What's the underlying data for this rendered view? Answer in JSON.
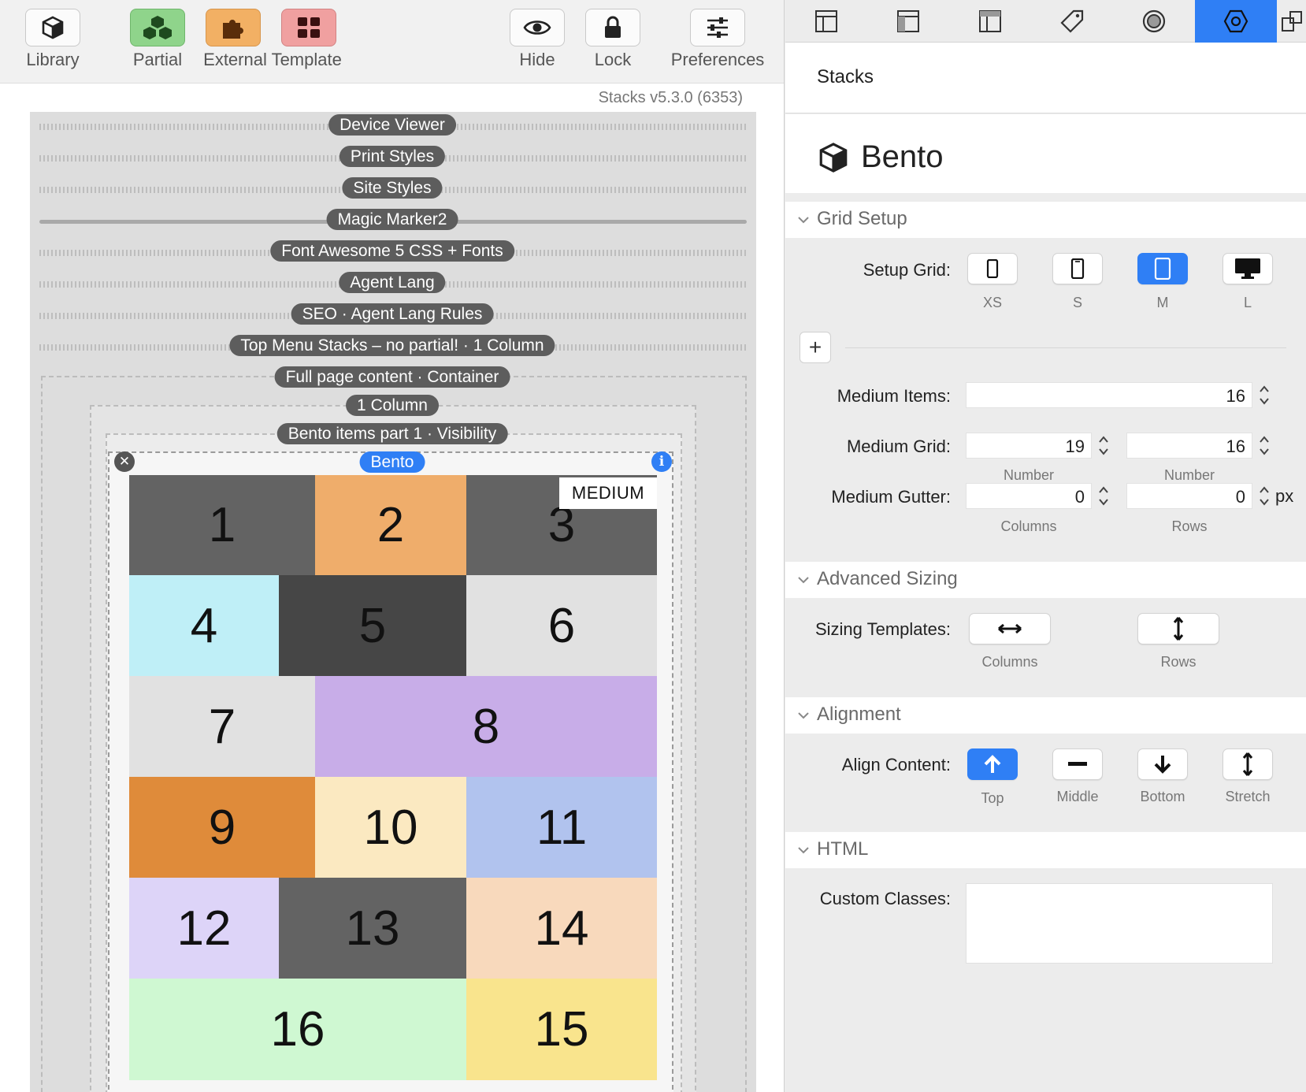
{
  "toolbar": {
    "library": "Library",
    "partial": "Partial",
    "external_template": "External Template",
    "hide": "Hide",
    "lock": "Lock",
    "preferences": "Preferences"
  },
  "version": "Stacks v5.3.0 (6353)",
  "stacks": [
    "Device Viewer",
    "Print Styles",
    "Site Styles",
    "Magic Marker2",
    "Font Awesome 5 CSS + Fonts",
    "Agent Lang",
    "SEO · Agent Lang Rules",
    "Top Menu Stacks – no partial! · 1 Column",
    "Full page content ·  Container",
    "1 Column",
    "Bento items part 1 · Visibility",
    "Bento"
  ],
  "bento": {
    "medium_tag": "MEDIUM",
    "cells": [
      {
        "label": "1",
        "color": "#636363"
      },
      {
        "label": "2",
        "color": "#efad6b"
      },
      {
        "label": "3",
        "color": "#636363"
      },
      {
        "label": "4",
        "color": "#bfeff7"
      },
      {
        "label": "5",
        "color": "#464646"
      },
      {
        "label": "6",
        "color": "#e1e1e1"
      },
      {
        "label": "7",
        "color": "#e1e1e1"
      },
      {
        "label": "8",
        "color": "#c8ade8"
      },
      {
        "label": "9",
        "color": "#df8b3a"
      },
      {
        "label": "10",
        "color": "#fbe9c1"
      },
      {
        "label": "11",
        "color": "#b1c3ee"
      },
      {
        "label": "12",
        "color": "#ddd4f8"
      },
      {
        "label": "13",
        "color": "#636363"
      },
      {
        "label": "14",
        "color": "#f8d9bc"
      },
      {
        "label": "16",
        "color": "#cff8d2"
      },
      {
        "label": "15",
        "color": "#f9e48d"
      }
    ]
  },
  "inspector": {
    "header": "Stacks",
    "stack_name": "Bento",
    "sections": {
      "grid_setup": "Grid Setup",
      "advanced_sizing": "Advanced Sizing",
      "alignment": "Alignment",
      "html": "HTML"
    },
    "setup_grid": {
      "label": "Setup Grid:",
      "options": [
        "XS",
        "S",
        "M",
        "L"
      ],
      "selected": "M"
    },
    "medium_items": {
      "label": "Medium Items:",
      "value": "16"
    },
    "medium_grid": {
      "label": "Medium Grid:",
      "value1": "19",
      "value2": "16",
      "sub1": "Number",
      "sub2": "Number"
    },
    "medium_gutter": {
      "label": "Medium Gutter:",
      "value1": "0",
      "value2": "0",
      "unit": "px",
      "sub1": "Columns",
      "sub2": "Rows"
    },
    "sizing_templates": {
      "label": "Sizing Templates:",
      "columns": "Columns",
      "rows": "Rows"
    },
    "align_content": {
      "label": "Align Content:",
      "options": [
        "Top",
        "Middle",
        "Bottom",
        "Stretch"
      ],
      "selected": "Top"
    },
    "custom_classes": {
      "label": "Custom Classes:",
      "value": ""
    }
  },
  "colors": {
    "accent": "#2f7ff5",
    "pill": "#5d5d5d"
  }
}
